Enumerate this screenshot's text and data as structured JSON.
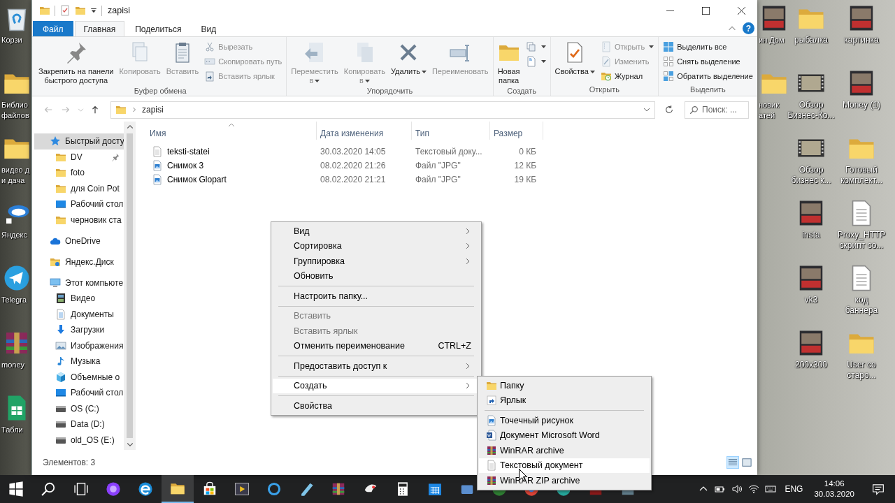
{
  "desktop": {
    "columns": [
      {
        "icons": [
          {
            "label": "Корзи",
            "kind": "recycle"
          },
          {
            "label": "Библио\nфайлов",
            "kind": "folder"
          },
          {
            "label": "видео д\nи дача",
            "kind": "folder"
          },
          {
            "label": "Яндекс",
            "kind": "dish"
          },
          {
            "label": "Telegra",
            "kind": "plane"
          },
          {
            "label": "money",
            "kind": "archive"
          },
          {
            "label": "Табли",
            "kind": "sheet"
          }
        ]
      },
      {
        "icons": [
          {
            "label": "ин Дом",
            "kind": "photo"
          },
          {
            "label": "новик\nатей",
            "kind": "folder"
          }
        ]
      },
      {
        "icons": [
          {
            "label": "рыбалка",
            "kind": "folder"
          },
          {
            "label": "Обзор\nБизнес-Ко...",
            "kind": "video"
          },
          {
            "label": "Обзор\nбизнес к...",
            "kind": "video"
          },
          {
            "label": "insta",
            "kind": "photo"
          },
          {
            "label": "vk3",
            "kind": "photo"
          },
          {
            "label": "200x300",
            "kind": "photo"
          }
        ]
      },
      {
        "icons": [
          {
            "label": "картинка",
            "kind": "photo"
          },
          {
            "label": "Money (1)",
            "kind": "photo"
          },
          {
            "label": "Готовый\nкомплект...",
            "kind": "folder"
          },
          {
            "label": "Proxy_HTTP\nскрипт со...",
            "kind": "document"
          },
          {
            "label": "код\nбаннера",
            "kind": "document"
          },
          {
            "label": "User со\nстаро...",
            "kind": "folder"
          }
        ]
      }
    ]
  },
  "explorer": {
    "title": "zapisi",
    "tabs": [
      {
        "label": "Файл",
        "kind": "file",
        "selected": false
      },
      {
        "label": "Главная",
        "kind": "tab",
        "selected": true
      },
      {
        "label": "Поделиться",
        "kind": "tab",
        "selected": false
      },
      {
        "label": "Вид",
        "kind": "tab",
        "selected": false
      }
    ],
    "help": "?",
    "ribbon": [
      {
        "label": "Буфер обмена",
        "buttons": [
          {
            "kind": "large",
            "label": "Закрепить на панели\nбыстрого доступа",
            "disabled": false,
            "menu": false
          },
          {
            "kind": "large",
            "label": "Копировать",
            "disabled": true,
            "menu": false
          },
          {
            "kind": "large",
            "label": "Вставить",
            "disabled": true,
            "menu": false
          },
          {
            "kind": "stack",
            "items": [
              {
                "label": "Вырезать",
                "disabled": true,
                "menu": false
              },
              {
                "label": "Скопировать путь",
                "disabled": true,
                "menu": false
              },
              {
                "label": "Вставить ярлык",
                "disabled": true,
                "menu": false
              }
            ]
          }
        ]
      },
      {
        "label": "Упорядочить",
        "buttons": [
          {
            "kind": "large",
            "label": "Переместить\nв",
            "disabled": true,
            "menu": true
          },
          {
            "kind": "large",
            "label": "Копировать\nв",
            "disabled": true,
            "menu": true
          },
          {
            "kind": "large",
            "label": "Удалить",
            "disabled": false,
            "menu": true
          },
          {
            "kind": "large",
            "label": "Переименовать",
            "disabled": true,
            "menu": false
          }
        ]
      },
      {
        "label": "Создать",
        "buttons": [
          {
            "kind": "large",
            "label": "Новая\nпапка",
            "disabled": false,
            "menu": false
          },
          {
            "kind": "stack",
            "items": [
              {
                "menu": true
              },
              {
                "menu": true
              }
            ]
          }
        ]
      },
      {
        "label": "Открыть",
        "buttons": [
          {
            "kind": "large",
            "label": "Свойства",
            "disabled": false,
            "menu": true
          },
          {
            "kind": "stack",
            "items": [
              {
                "label": "Открыть",
                "disabled": true,
                "menu": true
              },
              {
                "label": "Изменить",
                "disabled": true,
                "menu": false
              },
              {
                "label": "Журнал",
                "disabled": false,
                "menu": false
              }
            ]
          }
        ]
      },
      {
        "label": "Выделить",
        "buttons": [
          {
            "kind": "stack",
            "items": [
              {
                "label": "Выделить все",
                "disabled": false,
                "menu": false
              },
              {
                "label": "Снять выделение",
                "disabled": false,
                "menu": false
              },
              {
                "label": "Обратить выделение",
                "disabled": false,
                "menu": false
              }
            ]
          }
        ]
      }
    ],
    "address": {
      "path": "zapisi",
      "search_placeholder": "Поиск: ..."
    },
    "nav": [
      {
        "label": "Быстрый досту",
        "kind": "quick",
        "selected": true,
        "children": [
          {
            "label": "DV",
            "kind": "folder",
            "pinned": true,
            "selected": false
          },
          {
            "label": "foto",
            "kind": "folder",
            "pinned": false,
            "selected": false
          },
          {
            "label": "для Coin Pot",
            "kind": "folder",
            "pinned": false,
            "selected": false
          },
          {
            "label": "Рабочий стол",
            "kind": "desktop",
            "pinned": false,
            "selected": false
          },
          {
            "label": "черновик ста",
            "kind": "folder",
            "pinned": false,
            "selected": false
          }
        ]
      },
      {
        "label": "OneDrive",
        "kind": "cloud",
        "selected": false
      },
      {
        "label": "Яндекс.Диск",
        "kind": "cloud-folder",
        "selected": false
      },
      {
        "label": "Этот компьюте",
        "kind": "computer",
        "selected": false,
        "children": [
          {
            "label": "Видео",
            "kind": "videos",
            "selected": false
          },
          {
            "label": "Документы",
            "kind": "documents",
            "selected": false
          },
          {
            "label": "Загрузки",
            "kind": "downloads",
            "selected": false
          },
          {
            "label": "Изображения",
            "kind": "pictures",
            "selected": false
          },
          {
            "label": "Музыка",
            "kind": "music",
            "selected": false
          },
          {
            "label": "Объемные о",
            "kind": "objects",
            "selected": false
          },
          {
            "label": "Рабочий стол",
            "kind": "desktop",
            "selected": false
          },
          {
            "label": "OS (C:)",
            "kind": "drive",
            "selected": false
          },
          {
            "label": "Data (D:)",
            "kind": "drive",
            "selected": false
          },
          {
            "label": "old_OS (E:)",
            "kind": "drive",
            "selected": false
          }
        ]
      }
    ],
    "files": {
      "columns": [
        {
          "label": "Имя",
          "sorted": true
        },
        {
          "label": "Дата изменения",
          "sorted": false
        },
        {
          "label": "Тип",
          "sorted": false
        },
        {
          "label": "Размер",
          "sorted": false
        }
      ],
      "rows": [
        {
          "name": "teksti-statei",
          "kind": "text",
          "date": "30.03.2020 14:05",
          "type": "Текстовый доку...",
          "size": "0 КБ"
        },
        {
          "name": "Снимок 3",
          "kind": "image",
          "date": "08.02.2020 21:26",
          "type": "Файл \"JPG\"",
          "size": "12 КБ"
        },
        {
          "name": "Снимок Glopart",
          "kind": "image",
          "date": "08.02.2020 21:21",
          "type": "Файл \"JPG\"",
          "size": "19 КБ"
        }
      ]
    },
    "status": {
      "text": "Элементов: 3",
      "views": [
        {
          "selected": true
        },
        {
          "selected": false
        }
      ]
    }
  },
  "context_menu": [
    {
      "kind": "item",
      "label": "Вид",
      "submenu": true,
      "disabled": false,
      "selected": false
    },
    {
      "kind": "item",
      "label": "Сортировка",
      "submenu": true,
      "disabled": false,
      "selected": false
    },
    {
      "kind": "item",
      "label": "Группировка",
      "submenu": true,
      "disabled": false,
      "selected": false
    },
    {
      "kind": "item",
      "label": "Обновить",
      "submenu": false,
      "disabled": false,
      "selected": false
    },
    {
      "kind": "separator"
    },
    {
      "kind": "item",
      "label": "Настроить папку...",
      "submenu": false,
      "disabled": false,
      "selected": false
    },
    {
      "kind": "separator"
    },
    {
      "kind": "item",
      "label": "Вставить",
      "submenu": false,
      "disabled": true,
      "selected": false
    },
    {
      "kind": "item",
      "label": "Вставить ярлык",
      "submenu": false,
      "disabled": true,
      "selected": false
    },
    {
      "kind": "item",
      "label": "Отменить переименование",
      "shortcut": "CTRL+Z",
      "submenu": false,
      "disabled": false,
      "selected": false
    },
    {
      "kind": "separator"
    },
    {
      "kind": "item",
      "label": "Предоставить доступ к",
      "submenu": true,
      "disabled": false,
      "selected": false
    },
    {
      "kind": "separator"
    },
    {
      "kind": "item",
      "label": "Создать",
      "submenu": true,
      "disabled": false,
      "selected": true
    },
    {
      "kind": "separator"
    },
    {
      "kind": "item",
      "label": "Свойства",
      "submenu": false,
      "disabled": false,
      "selected": false
    }
  ],
  "submenu": [
    {
      "kind": "folder",
      "label": "Папку",
      "selected": false
    },
    {
      "kind": "shortcut",
      "label": "Ярлык",
      "selected": false
    },
    {
      "kind": "separator"
    },
    {
      "kind": "image",
      "label": "Точечный рисунок",
      "selected": false
    },
    {
      "kind": "word",
      "label": "Документ Microsoft Word",
      "selected": false
    },
    {
      "kind": "archive",
      "label": "WinRAR archive",
      "selected": false
    },
    {
      "kind": "text",
      "label": "Текстовый документ",
      "selected": true
    },
    {
      "kind": "archive",
      "label": "WinRAR ZIP archive",
      "selected": false
    }
  ],
  "taskbar": {
    "apps": [
      {
        "active": false
      },
      {
        "active": false
      },
      {
        "active": false
      },
      {
        "active": false
      },
      {
        "active": false
      },
      {
        "active": true
      },
      {
        "active": false
      },
      {
        "active": false
      },
      {
        "active": false
      },
      {
        "active": false
      },
      {
        "active": false
      },
      {
        "active": false
      },
      {
        "active": false
      },
      {
        "active": false
      },
      {
        "active": false
      },
      {
        "active": false
      },
      {
        "active": false
      },
      {
        "active": false
      },
      {
        "active": false
      },
      {
        "active": false
      }
    ],
    "language": "ENG",
    "time": "14:06",
    "date": "30.03.2020"
  }
}
